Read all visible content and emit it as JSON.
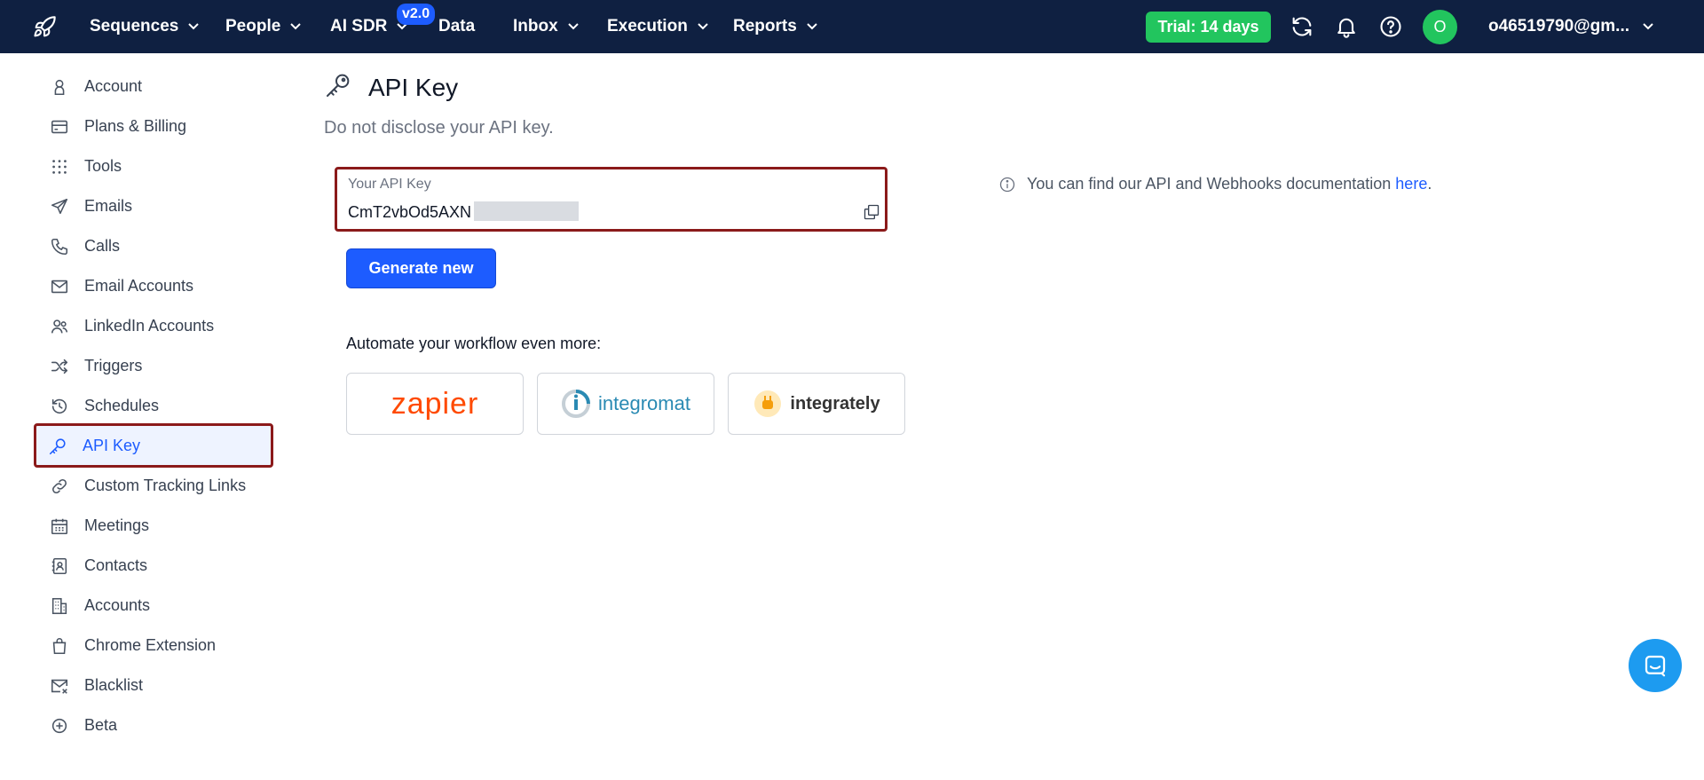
{
  "nav": {
    "items": [
      {
        "label": "Sequences",
        "has_chevron": true
      },
      {
        "label": "People",
        "has_chevron": true
      },
      {
        "label": "AI SDR",
        "has_chevron": true
      },
      {
        "label": "Data",
        "has_chevron": false
      },
      {
        "label": "Inbox",
        "has_chevron": true
      },
      {
        "label": "Execution",
        "has_chevron": true
      },
      {
        "label": "Reports",
        "has_chevron": true
      }
    ],
    "ai_sdr_badge": "v2.0",
    "trial_label": "Trial: 14 days",
    "avatar_initial": "O",
    "user_email": "o46519790@gm...",
    "colors": {
      "bar": "#0f2041",
      "trial": "#22c55e",
      "accent": "#1d5cff"
    }
  },
  "sidebar": {
    "items": [
      {
        "label": "Account",
        "icon": "user-icon"
      },
      {
        "label": "Plans & Billing",
        "icon": "credit-card-icon"
      },
      {
        "label": "Tools",
        "icon": "grid-icon"
      },
      {
        "label": "Emails",
        "icon": "paper-plane-icon"
      },
      {
        "label": "Calls",
        "icon": "phone-icon"
      },
      {
        "label": "Email Accounts",
        "icon": "envelope-icon"
      },
      {
        "label": "LinkedIn Accounts",
        "icon": "users-icon"
      },
      {
        "label": "Triggers",
        "icon": "shuffle-icon"
      },
      {
        "label": "Schedules",
        "icon": "history-icon"
      },
      {
        "label": "API Key",
        "icon": "key-icon",
        "active": true
      },
      {
        "label": "Custom Tracking Links",
        "icon": "link-icon"
      },
      {
        "label": "Meetings",
        "icon": "calendar-icon"
      },
      {
        "label": "Contacts",
        "icon": "contact-book-icon"
      },
      {
        "label": "Accounts",
        "icon": "building-icon"
      },
      {
        "label": "Chrome Extension",
        "icon": "shopping-bag-icon"
      },
      {
        "label": "Blacklist",
        "icon": "envelope-x-icon"
      },
      {
        "label": "Beta",
        "icon": "plus-circle-icon"
      }
    ]
  },
  "main": {
    "title": "API Key",
    "subtitle": "Do not disclose your API key.",
    "api_key": {
      "label": "Your API Key",
      "value": "CmT2vbOd5AXN"
    },
    "generate_label": "Generate new",
    "automate_label": "Automate your workflow even more:",
    "integrations": [
      {
        "name": "zapier"
      },
      {
        "name": "integromat"
      },
      {
        "name": "integrately"
      }
    ],
    "info": {
      "text": "You can find our API and Webhooks documentation",
      "link": "here",
      "suffix": "."
    }
  }
}
